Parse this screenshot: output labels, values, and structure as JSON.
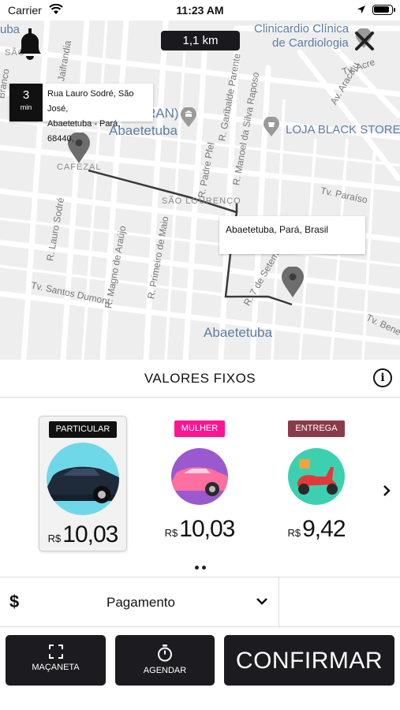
{
  "status_bar": {
    "carrier": "Carrier",
    "time": "11:23 AM"
  },
  "map": {
    "distance": "1,1 km",
    "eta": {
      "value": "3",
      "unit": "min",
      "address_line1": "Rua Lauro Sodré, São José,",
      "address_line2": "Abaetetuba - Pará, 68440,"
    },
    "destination": "Abaetetuba, Pará, Brasil",
    "labels": {
      "poi_clinic_1": "Clinicardio Clínica",
      "poi_clinic_2": "de Cardiologia",
      "city_top": "Abaetetuba",
      "city_bottom": "Abaetetuba",
      "store": "LOJA BLACK STORE",
      "ran": "RAN)",
      "hood_cafezal": "CAFEZAL",
      "hood_sao_lourenco": "SÃO LOURENÇO",
      "hood_top_left": "SÃO",
      "street_lauro_sodre": "R. Lauro Sodré",
      "street_magno": "R. Magno de Araújo",
      "street_primeiro_maio": "R. Primeiro de Maio",
      "street_padre_pfel": "R. Padre Pfel",
      "street_garibalde": "R. Garibalde Parente",
      "street_manoel": "R. Manoel da Silva Raposo",
      "street_aracaju": "Av. Aracaju",
      "street_acre": "Tv. Acre",
      "street_paraiso": "Tv. Paraíso",
      "street_santos_dumont": "Tv. Santos Dumont",
      "street_7set": "R. 7 de Setembro",
      "street_benedito": "Tv. Bened",
      "street_jaifrandia": "Jaifrandia",
      "street_branco": "Branco",
      "street_ruba": "uba"
    }
  },
  "fixed_values": {
    "title": "VALORES FIXOS",
    "info_icon": "info-icon"
  },
  "options": [
    {
      "tag": "PARTICULAR",
      "tag_color": "#111111",
      "circle_color": "#6fd8e8",
      "car_color": "#1f2a3a",
      "currency": "R$",
      "price": "10,03",
      "selected": true
    },
    {
      "tag": "MULHER",
      "tag_color": "#ff1493",
      "circle_color": "#9b59d0",
      "car_color": "#ff6fa0",
      "currency": "R$",
      "price": "10,03",
      "selected": false
    },
    {
      "tag": "ENTREGA",
      "tag_color": "#8a3a48",
      "circle_color": "#3cd0b0",
      "car_color": "#e23a3a",
      "currency": "R$",
      "price": "9,42",
      "selected": false
    }
  ],
  "payment": {
    "label": "Pagamento",
    "currency_icon": "$"
  },
  "buttons": {
    "handle": "MAÇANETA",
    "schedule": "AGENDAR",
    "confirm": "CONFIRMAR"
  }
}
